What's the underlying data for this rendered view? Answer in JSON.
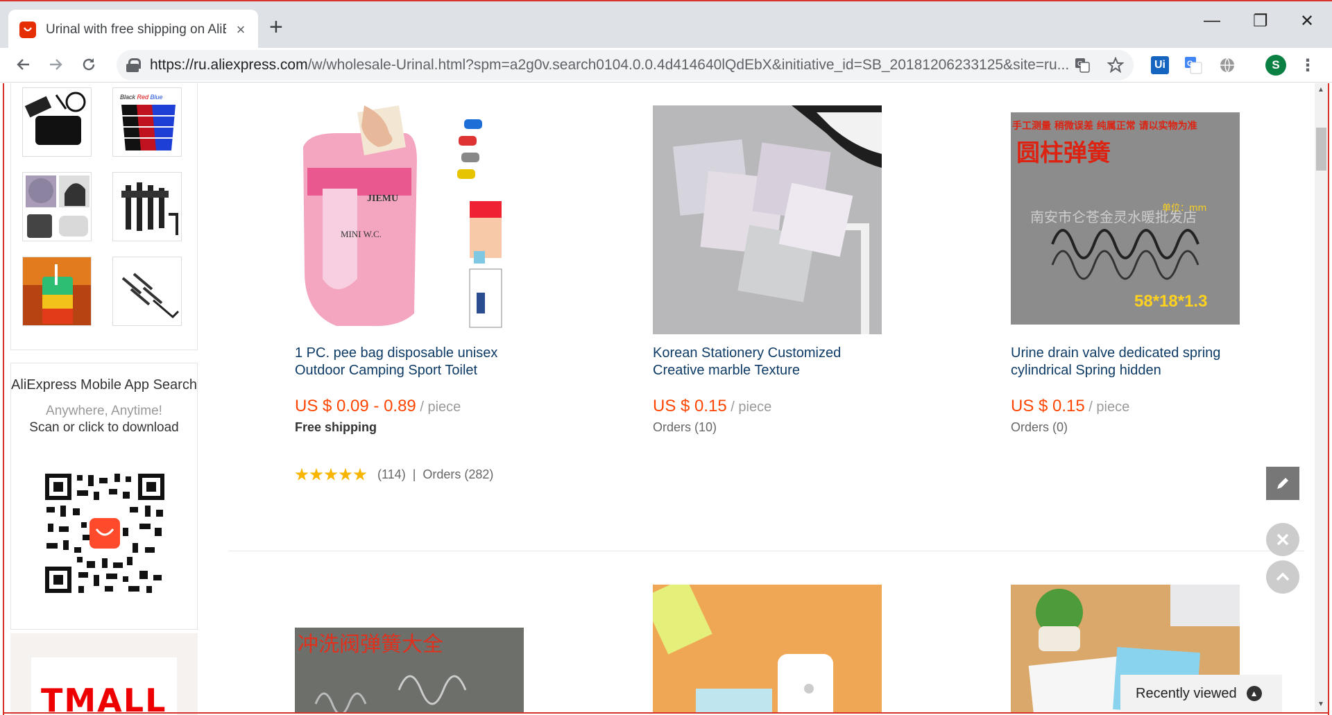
{
  "browser": {
    "tab_title": "Urinal with free shipping on AliExpress",
    "tab_close": "×",
    "new_tab": "+",
    "url_host": "https://ru.aliexpress.com",
    "url_path": "/w/wholesale-Urinal.html?spm=a2g0v.search0104.0.0.4d414640lQdEbX&initiative_id=SB_20181206233125&site=ru...",
    "profile_initial": "S",
    "ext_ui_label": "Ui",
    "minimize": "—",
    "restore": "❐",
    "close": "✕"
  },
  "sidebar": {
    "app_title": "AliExpress Mobile App Search",
    "app_tagline": "Anywhere, Anytime!",
    "app_download": "Scan or click to download",
    "tmall_logo_text": "TMALL"
  },
  "products": [
    {
      "title": "1 PC. pee bag disposable unisex Outdoor Camping Sport Toilet",
      "price": "US $ 0.09 - 0.89",
      "unit": " / piece",
      "shipping": "Free shipping",
      "rating_count": "(114)",
      "separator": "|",
      "orders": "Orders (282)",
      "stars": 5
    },
    {
      "title": "Korean Stationery Customized Creative marble Texture",
      "price": "US $ 0.15",
      "unit": " / piece",
      "orders": "Orders (10)"
    },
    {
      "title": "Urine drain valve dedicated spring cylindrical Spring hidden",
      "price": "US $ 0.15",
      "unit": " / piece",
      "orders": "Orders (0)",
      "image_text_cn_top": "手工测量 稍微误差 纯属正常 请以实物为准",
      "image_text_cn_title": "圆柱弹簧",
      "image_text_cn_watermark": "南安市仑苍金灵水暖批发店",
      "image_text_unit": "单位：mm",
      "image_text_size": "58*18*1.3"
    },
    {
      "image_text_cn_title": "冲洗阀弹簧大全"
    }
  ],
  "widgets": {
    "recently_viewed": "Recently viewed"
  },
  "colors": {
    "accent_price": "#ff4500",
    "title_blue": "#0d3b66",
    "frame_red": "#d9312b",
    "star": "#f7b500"
  }
}
